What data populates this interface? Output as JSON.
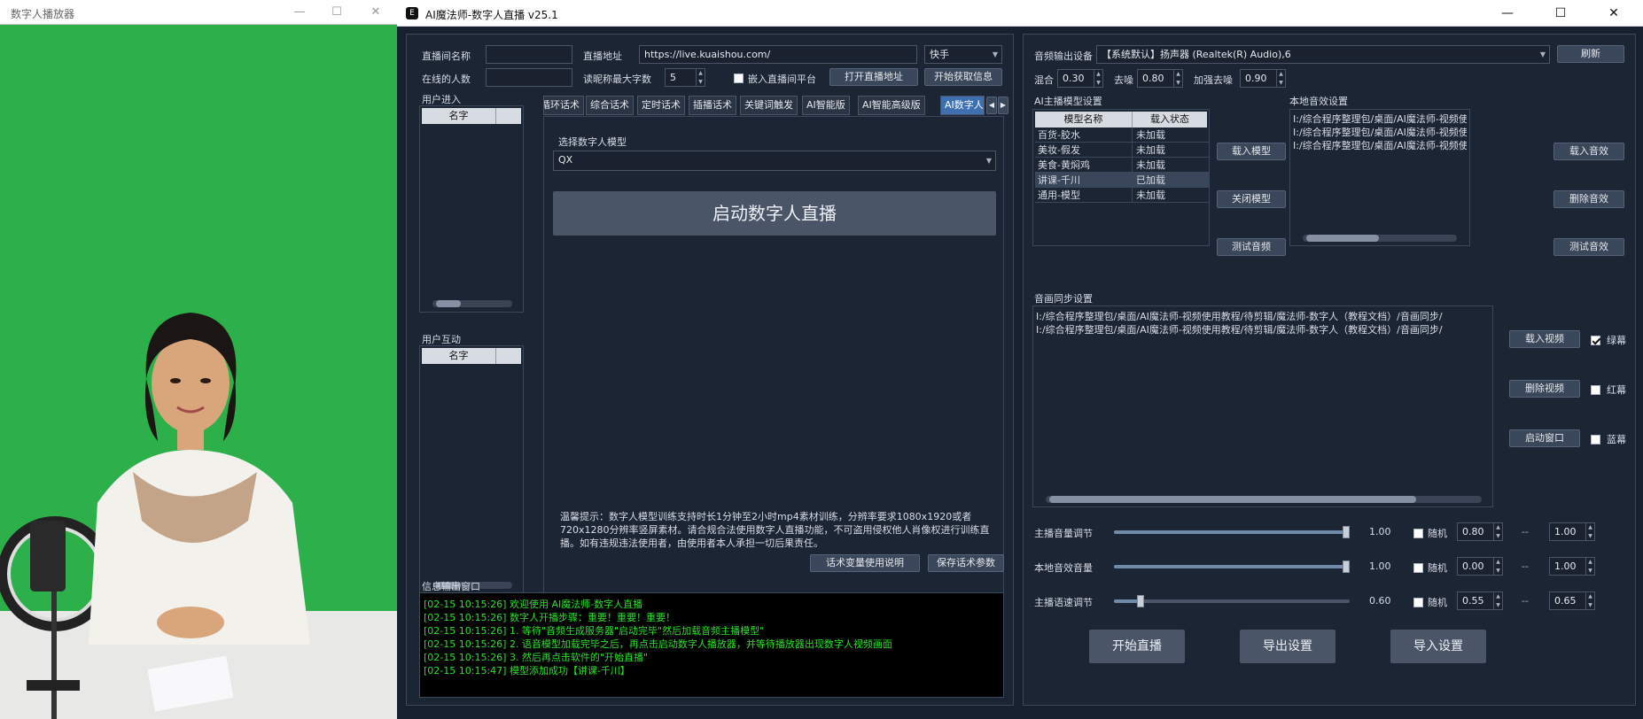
{
  "player": {
    "title": "数字人播放器"
  },
  "app": {
    "title": "AI魔法师-数字人直播 v25.1",
    "logo_text": "E"
  },
  "live": {
    "room_name_label": "直播间名称",
    "room_name_value": "",
    "address_label": "直播地址",
    "address_value": "https://live.kuaishou.com/",
    "platform": "快手",
    "online_label": "在线的人数",
    "online_value": "",
    "nick_max_label": "读昵称最大字数",
    "nick_max_value": "5",
    "embed_label": "嵌入直播间平台",
    "open_address_button": "打开直播地址",
    "fetch_info_button": "开始获取信息"
  },
  "user_enter": {
    "label": "用户进入",
    "col": "名字"
  },
  "user_interact": {
    "label": "用户互动",
    "col": "名字"
  },
  "tabs": [
    "循环话术",
    "综合话术",
    "定时话术",
    "插播话术",
    "关键词触发",
    "AI智能版",
    "AI智能高级版",
    "AI数字人"
  ],
  "digital": {
    "select_label": "选择数字人模型",
    "select_value": "QX",
    "start_button": "启动数字人直播",
    "tip": "温馨提示：数字人模型训练支持时长1分钟至2小时mp4素材训练，分辨率要求1080x1920或者720x1280分辨率竖屏素材。请合规合法使用数字人直播功能，不可盗用侵权他人肖像权进行训练直播。如有违规违法使用者，由使用者本人承担一切后果责任。"
  },
  "script_buttons": {
    "vars": "话术变量使用说明",
    "save": "保存话术参数"
  },
  "log": {
    "label": "信息输出窗口",
    "lines": [
      "[02-15 10:15:26] 欢迎使用 AI魔法师-数字人直播",
      "[02-15 10:15:26] 数字人开播步骤：重要！重要！重要！",
      "[02-15 10:15:26] 1. 等待\"音频生成服务器\"启动完毕\"然后加载音频主播模型\"",
      "[02-15 10:15:26] 2. 语音模型加载完毕之后，再点击启动数字人播放器，并等待播放器出现数字人视频画面",
      "[02-15 10:15:26] 3. 然后再点击软件的\"开始直播\"",
      "[02-15 10:15:47] 模型添加成功【讲课-千川】"
    ]
  },
  "audio": {
    "device_label": "音频输出设备",
    "device_value": "【系统默认】扬声器 (Realtek(R) Audio),6",
    "refresh": "刷新",
    "mix_label": "混合",
    "mix_value": "0.30",
    "denoise_label": "去噪",
    "denoise_value": "0.80",
    "enh_label": "加强去噪",
    "enh_value": "0.90"
  },
  "ai_model": {
    "label": "AI主播模型设置",
    "cols": [
      "模型名称",
      "载入状态"
    ],
    "rows": [
      [
        "百货-胶水",
        "未加载"
      ],
      [
        "美妆-假发",
        "未加载"
      ],
      [
        "美食-黄焖鸡",
        "未加载"
      ],
      [
        "讲课-千川",
        "已加载"
      ],
      [
        "通用-模型",
        "未加载"
      ]
    ],
    "load_btn": "载入模型",
    "close_btn": "关闭模型",
    "test_btn": "测试音频"
  },
  "local_fx": {
    "label": "本地音效设置",
    "items": [
      "I:/综合程序整理包/桌面/AI魔法师-视频使用",
      "I:/综合程序整理包/桌面/AI魔法师-视频使用",
      "I:/综合程序整理包/桌面/AI魔法师-视频使用"
    ],
    "load_btn": "载入音效",
    "del_btn": "删除音效",
    "test_btn": "测试音效"
  },
  "av_sync": {
    "label": "音画同步设置",
    "items": [
      "I:/综合程序整理包/桌面/AI魔法师-视频使用教程/待剪辑/魔法师-数字人（教程文档）/音画同步/",
      "I:/综合程序整理包/桌面/AI魔法师-视频使用教程/待剪辑/魔法师-数字人（教程文档）/音画同步/"
    ],
    "load_video": "载入视频",
    "del_video": "删除视频",
    "start_window": "启动窗口",
    "green": "绿幕",
    "red": "红幕",
    "blue": "蓝幕"
  },
  "sliders": [
    {
      "label": "主播音量调节",
      "value": "1.00",
      "level": 1.0,
      "random": "随机",
      "min": "0.80",
      "sep": "--",
      "max": "1.00"
    },
    {
      "label": "本地音效音量",
      "value": "1.00",
      "level": 1.0,
      "random": "随机",
      "min": "0.00",
      "sep": "--",
      "max": "1.00"
    },
    {
      "label": "主播语速调节",
      "value": "0.60",
      "level": 0.1,
      "random": "随机",
      "min": "0.55",
      "sep": "--",
      "max": "0.65"
    }
  ],
  "bottom": {
    "start": "开始直播",
    "export": "导出设置",
    "import": "导入设置"
  }
}
